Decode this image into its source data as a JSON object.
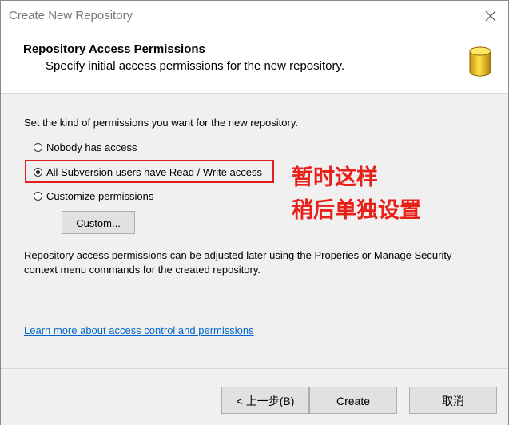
{
  "window": {
    "title": "Create New Repository"
  },
  "header": {
    "title": "Repository Access Permissions",
    "subtitle": "Specify initial access permissions for the new repository."
  },
  "content": {
    "intro": "Set the kind of permissions you want for the new repository.",
    "options": [
      {
        "label": "Nobody has access",
        "checked": false
      },
      {
        "label": "All Subversion users have Read / Write access",
        "checked": true
      },
      {
        "label": "Customize permissions",
        "checked": false
      }
    ],
    "custom_button": "Custom...",
    "note": "Repository access permissions can be adjusted later using the Properies or Manage Security context menu commands for the created repository.",
    "learn_link": "Learn more about access control and permissions"
  },
  "annotation": {
    "line1": "暂时这样",
    "line2": "稍后单独设置",
    "color": "#e8201a"
  },
  "footer": {
    "back_label": "< 上一步(B)",
    "create_label": "Create",
    "cancel_label": "取消"
  },
  "icons": {
    "close": "close-icon",
    "database": "database-icon"
  }
}
